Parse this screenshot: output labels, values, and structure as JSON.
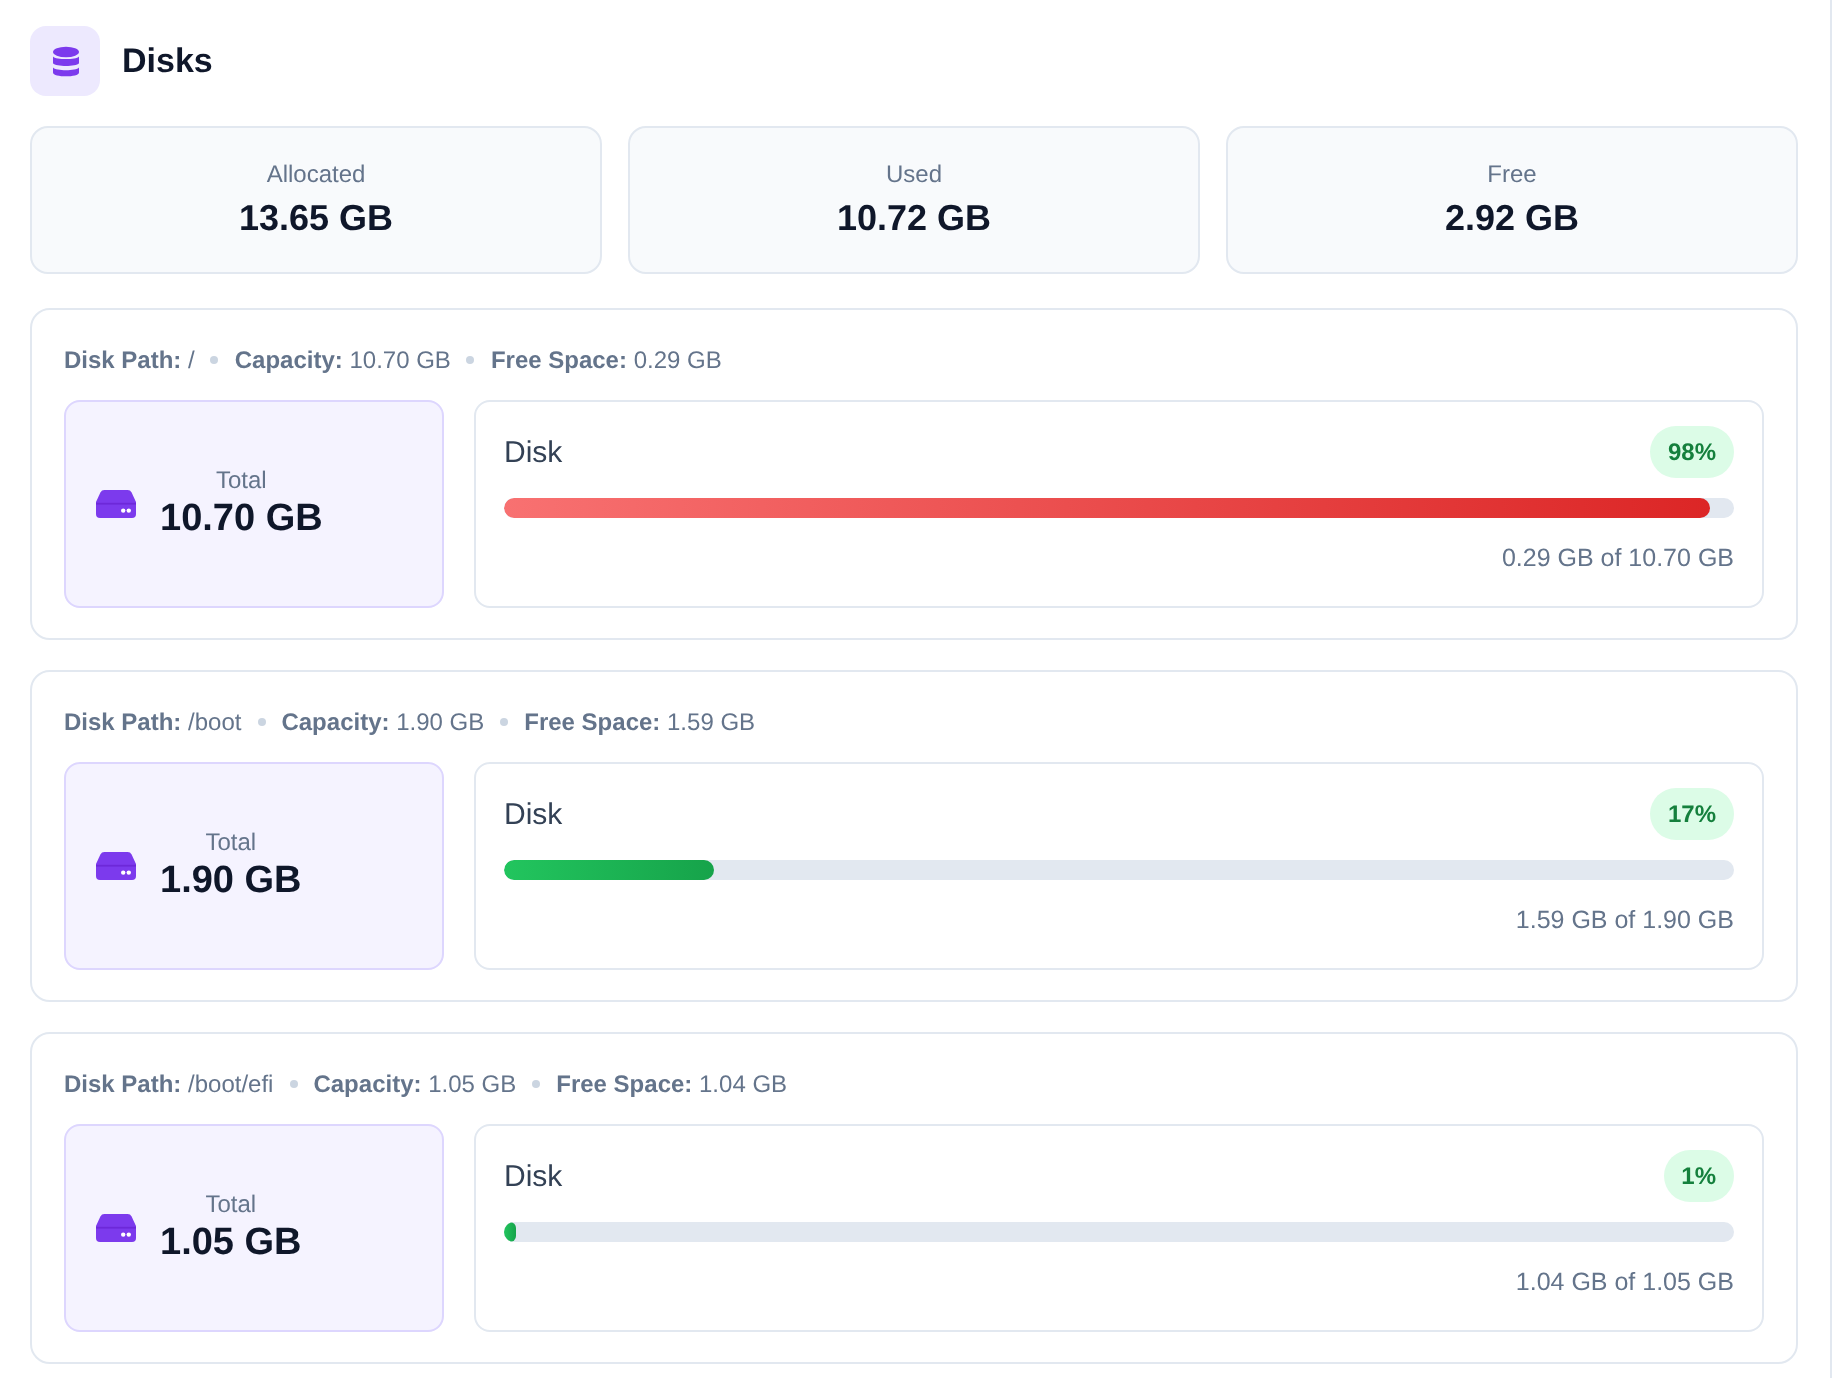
{
  "header": {
    "title": "Disks"
  },
  "summary": [
    {
      "label": "Allocated",
      "value": "13.65 GB"
    },
    {
      "label": "Used",
      "value": "10.72 GB"
    },
    {
      "label": "Free",
      "value": "2.92 GB"
    }
  ],
  "disks": [
    {
      "meta": [
        {
          "label": "Disk Path:",
          "value": "/"
        },
        {
          "label": "Capacity:",
          "value": "10.70 GB"
        },
        {
          "label": "Free Space:",
          "value": "0.29 GB"
        }
      ],
      "total_label": "Total",
      "total_value": "10.70 GB",
      "bar_label": "Disk",
      "percent": "98%",
      "level": 0.98,
      "usage": "0.29 GB of 10.70 GB"
    },
    {
      "meta": [
        {
          "label": "Disk Path:",
          "value": "/boot"
        },
        {
          "label": "Capacity:",
          "value": "1.90 GB"
        },
        {
          "label": "Free Space:",
          "value": "1.59 GB"
        }
      ],
      "total_label": "Total",
      "total_value": "1.90 GB",
      "bar_label": "Disk",
      "percent": "17%",
      "level": 0.17,
      "usage": "1.59 GB of 1.90 GB"
    },
    {
      "meta": [
        {
          "label": "Disk Path:",
          "value": "/boot/efi"
        },
        {
          "label": "Capacity:",
          "value": "1.05 GB"
        },
        {
          "label": "Free Space:",
          "value": "1.04 GB"
        }
      ],
      "total_label": "Total",
      "total_value": "1.05 GB",
      "bar_label": "Disk",
      "percent": "1%",
      "level": 0.01,
      "usage": "1.04 GB of 1.05 GB"
    }
  ]
}
